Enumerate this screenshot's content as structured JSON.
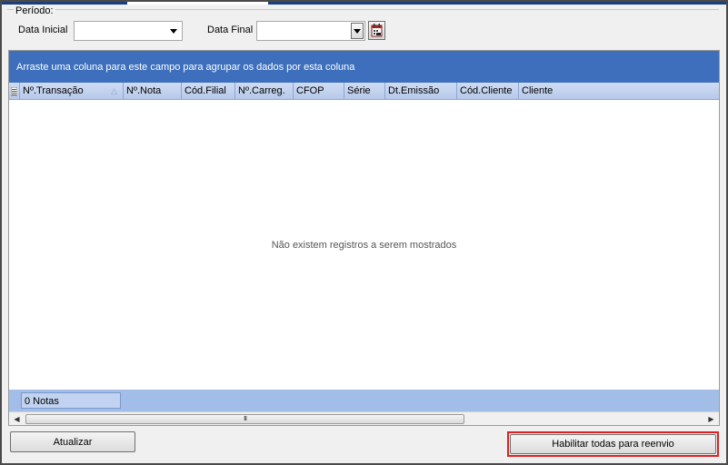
{
  "period": {
    "legend": "Período:",
    "start_label": "Data Inicial",
    "start_value": "",
    "end_label": "Data Final",
    "end_value": ""
  },
  "grid": {
    "group_panel_text": "Arraste uma coluna para este campo para agrupar os dados por esta coluna",
    "columns": [
      "Nº.Transação",
      "Nº.Nota",
      "Cód.Filial",
      "Nº.Carreg.",
      "CFOP",
      "Série",
      "Dt.Emissão",
      "Cód.Cliente",
      "Cliente"
    ],
    "empty_message": "Não existem registros a serem mostrados",
    "footer_count": "0 Notas",
    "scroll_grip": "III"
  },
  "buttons": {
    "refresh": "Atualizar",
    "enable_all": "Habilitar todas para reenvio"
  },
  "colors": {
    "group_panel": "#3d6fbd",
    "header": "#b7c9ea",
    "footer": "#a3bde9",
    "highlight": "#e02020"
  },
  "icons": {
    "calendar_button": "calendar-icon",
    "column_chooser": "column-chooser-icon"
  }
}
